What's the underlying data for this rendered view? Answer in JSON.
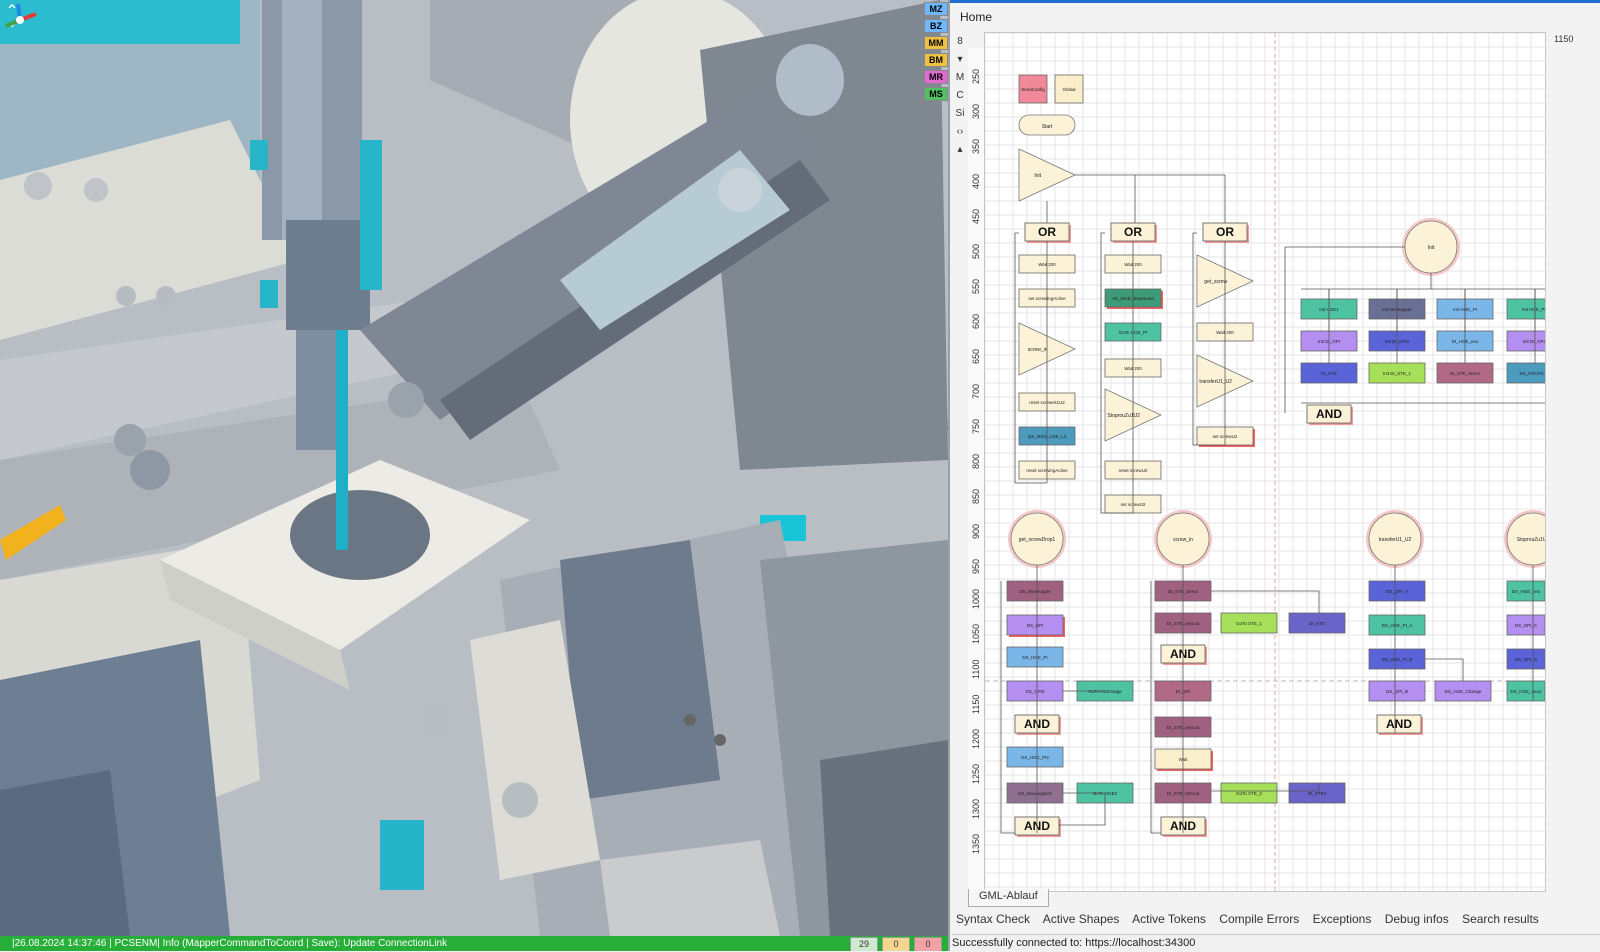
{
  "viewport": {
    "badges": [
      {
        "label": "MZ",
        "color": "#6fb8ff"
      },
      {
        "label": "BZ",
        "color": "#6fb8ff"
      },
      {
        "label": "MM",
        "color": "#f0c040"
      },
      {
        "label": "BM",
        "color": "#f0c040"
      },
      {
        "label": "MR",
        "color": "#e06ad0"
      },
      {
        "label": "MS",
        "color": "#50c060"
      }
    ]
  },
  "status": {
    "message": "|26.08.2024 14:37:46 | PCSENM| Info (MapperCommandToCoord | Save): Update ConnectionLink",
    "counts": [
      "29",
      "0",
      "0"
    ]
  },
  "panel": {
    "home": "Home",
    "ruler_top": [
      "350",
      "400",
      "450",
      "500",
      "550",
      "600",
      "650",
      "700",
      "750",
      "800",
      "850",
      "900",
      "950",
      "1000",
      "1050",
      "1100",
      "1150"
    ],
    "ruler_left": [
      "250",
      "300",
      "350",
      "400",
      "450",
      "500",
      "550",
      "600",
      "650",
      "700",
      "750",
      "800",
      "850",
      "900",
      "950",
      "1000",
      "1050",
      "1100",
      "1150",
      "1200",
      "1250",
      "1300",
      "1350"
    ],
    "tools": [
      "8",
      "▾",
      "M",
      "C",
      "Si",
      "‹›",
      "▴"
    ],
    "doc_tab": "GML-Ablauf",
    "tabs": [
      "Syntax Check",
      "Active Shapes",
      "Active Tokens",
      "Compile Errors",
      "Exceptions",
      "Debug infos",
      "Search results"
    ],
    "connection": "Successfully connected to: https://localhost:34300"
  },
  "flow": {
    "top_nodes": [
      {
        "label": "SendConfig",
        "color": "#f08a9a"
      },
      {
        "label": "Global",
        "color": "#fbeecb"
      },
      {
        "label": "Start",
        "color": "#fbeecb"
      },
      {
        "label": "Init",
        "color": "#fbeecb"
      }
    ],
    "gates": [
      "OR",
      "OR",
      "OR",
      "AND",
      "AND",
      "AND",
      "AND",
      "AND",
      "AND"
    ],
    "init_circle": "Init",
    "circles": [
      "get_screwDrop1",
      "screw_in",
      "transferU1_U2",
      "StoprouZu1U2"
    ],
    "col1": [
      "Wait 200",
      "set screwingActive",
      "screw_in",
      "reset screwAt1U2",
      "QS_MSG_USK_L3",
      "reset screwingActive"
    ],
    "col2": [
      "Wait 200",
      "VE_MGE_Stepmotor",
      "GoTo HGE_PI",
      "Wait 200",
      "StoprouZu1U2",
      "reset screwU2",
      "set screwU2"
    ],
    "col3": [
      "get_screw",
      "Wait 200",
      "transferU1_U2",
      "set screwU2"
    ],
    "init_boxes": [
      {
        "label": "Init HGE1",
        "color": "#4dc3a2"
      },
      {
        "label": "Init Moveupper",
        "color": "#6a6f96"
      },
      {
        "label": "Init HGE_PI",
        "color": "#7ab7e8"
      },
      {
        "label": "Init HGE_PI2",
        "color": "#4dc3a2"
      },
      {
        "label": "Init DI_GPI",
        "color": "#b48ff0"
      },
      {
        "label": "Init DI_GPI2",
        "color": "#5a64d8"
      },
      {
        "label": "DI_HGE_neu",
        "color": "#7ab7e8"
      },
      {
        "label": "Init DI_GPI3",
        "color": "#b48ff0"
      },
      {
        "label": "DI_STE",
        "color": "#5a64d8"
      },
      {
        "label": "Init DI_STE_1",
        "color": "#a6e05a"
      },
      {
        "label": "DI_STE_Servo",
        "color": "#b06a86"
      },
      {
        "label": "DS_FOUTS_DI",
        "color": "#4d9abf"
      }
    ],
    "bottom_labels": [
      {
        "label": "DS_Moveupper",
        "color": "#a06080"
      },
      {
        "label": "DS_GPI",
        "color": "#b48ff0"
      },
      {
        "label": "DS_HGE_PI",
        "color": "#7ab7e8"
      },
      {
        "label": "DS_GPI2",
        "color": "#b48ff0"
      },
      {
        "label": "GoTo HGEStage",
        "color": "#4dc3a2"
      },
      {
        "label": "DS_HGE_PI2",
        "color": "#7ab7e8"
      },
      {
        "label": "DS_Moveupper2",
        "color": "#8f7090"
      },
      {
        "label": "GoTo HGE2",
        "color": "#4dc3a2"
      },
      {
        "label": "DI_STE_Servo",
        "color": "#a06080"
      },
      {
        "label": "GoTo STE_1",
        "color": "#a6e05a"
      },
      {
        "label": "DI_STE",
        "color": "#6a64c8"
      },
      {
        "label": "DI_STE_Servo2",
        "color": "#a06080"
      },
      {
        "label": "DI_GPI",
        "color": "#b06a86"
      },
      {
        "label": "DI_STE_Servo3",
        "color": "#a06080"
      },
      {
        "label": "Wait",
        "color": "#fbeecb"
      },
      {
        "label": "DI_STE_Servo4",
        "color": "#a06080"
      },
      {
        "label": "GoTo STE_2",
        "color": "#a6e05a"
      },
      {
        "label": "DI_STE2",
        "color": "#6a64c8"
      },
      {
        "label": "DS_GPI_A",
        "color": "#5a64d8"
      },
      {
        "label": "DS_HGE_PI_A",
        "color": "#4dc3a2"
      },
      {
        "label": "DS_HGE_PI_B",
        "color": "#5a64d8"
      },
      {
        "label": "DS_GPI_B",
        "color": "#b48ff0"
      },
      {
        "label": "DS_HGE_Change",
        "color": "#b48ff0"
      },
      {
        "label": "DS_HGE_neu",
        "color": "#4dc3a2"
      },
      {
        "label": "DS_GPI_C",
        "color": "#b48ff0"
      },
      {
        "label": "DS_GPI_D",
        "color": "#5a64d8"
      },
      {
        "label": "DS_HGE_neu2",
        "color": "#4dc3a2"
      }
    ]
  }
}
